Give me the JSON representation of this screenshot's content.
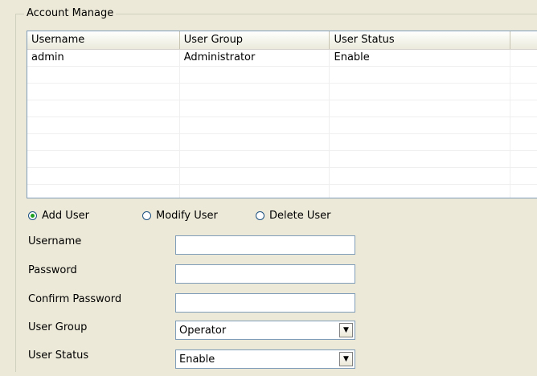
{
  "group": {
    "title": "Account Manage"
  },
  "table": {
    "columns": [
      "Username",
      "User Group",
      "User Status",
      ""
    ],
    "rows": [
      [
        "admin",
        "Administrator",
        "Enable",
        ""
      ],
      [
        "",
        "",
        "",
        ""
      ],
      [
        "",
        "",
        "",
        ""
      ],
      [
        "",
        "",
        "",
        ""
      ],
      [
        "",
        "",
        "",
        ""
      ],
      [
        "",
        "",
        "",
        ""
      ],
      [
        "",
        "",
        "",
        ""
      ],
      [
        "",
        "",
        "",
        ""
      ],
      [
        "",
        "",
        "",
        ""
      ]
    ]
  },
  "mode": {
    "selected": "add",
    "options": [
      {
        "id": "add",
        "label": "Add User"
      },
      {
        "id": "modify",
        "label": "Modify User"
      },
      {
        "id": "delete",
        "label": "Delete User"
      }
    ]
  },
  "form": {
    "username_label": "Username",
    "username_value": "",
    "password_label": "Password",
    "password_value": "",
    "confirm_label": "Confirm Password",
    "confirm_value": "",
    "group_label": "User Group",
    "group_value": "Operator",
    "status_label": "User Status",
    "status_value": "Enable"
  },
  "icons": {
    "dropdown": "chevron-down-icon",
    "radio": "radio-icon"
  }
}
